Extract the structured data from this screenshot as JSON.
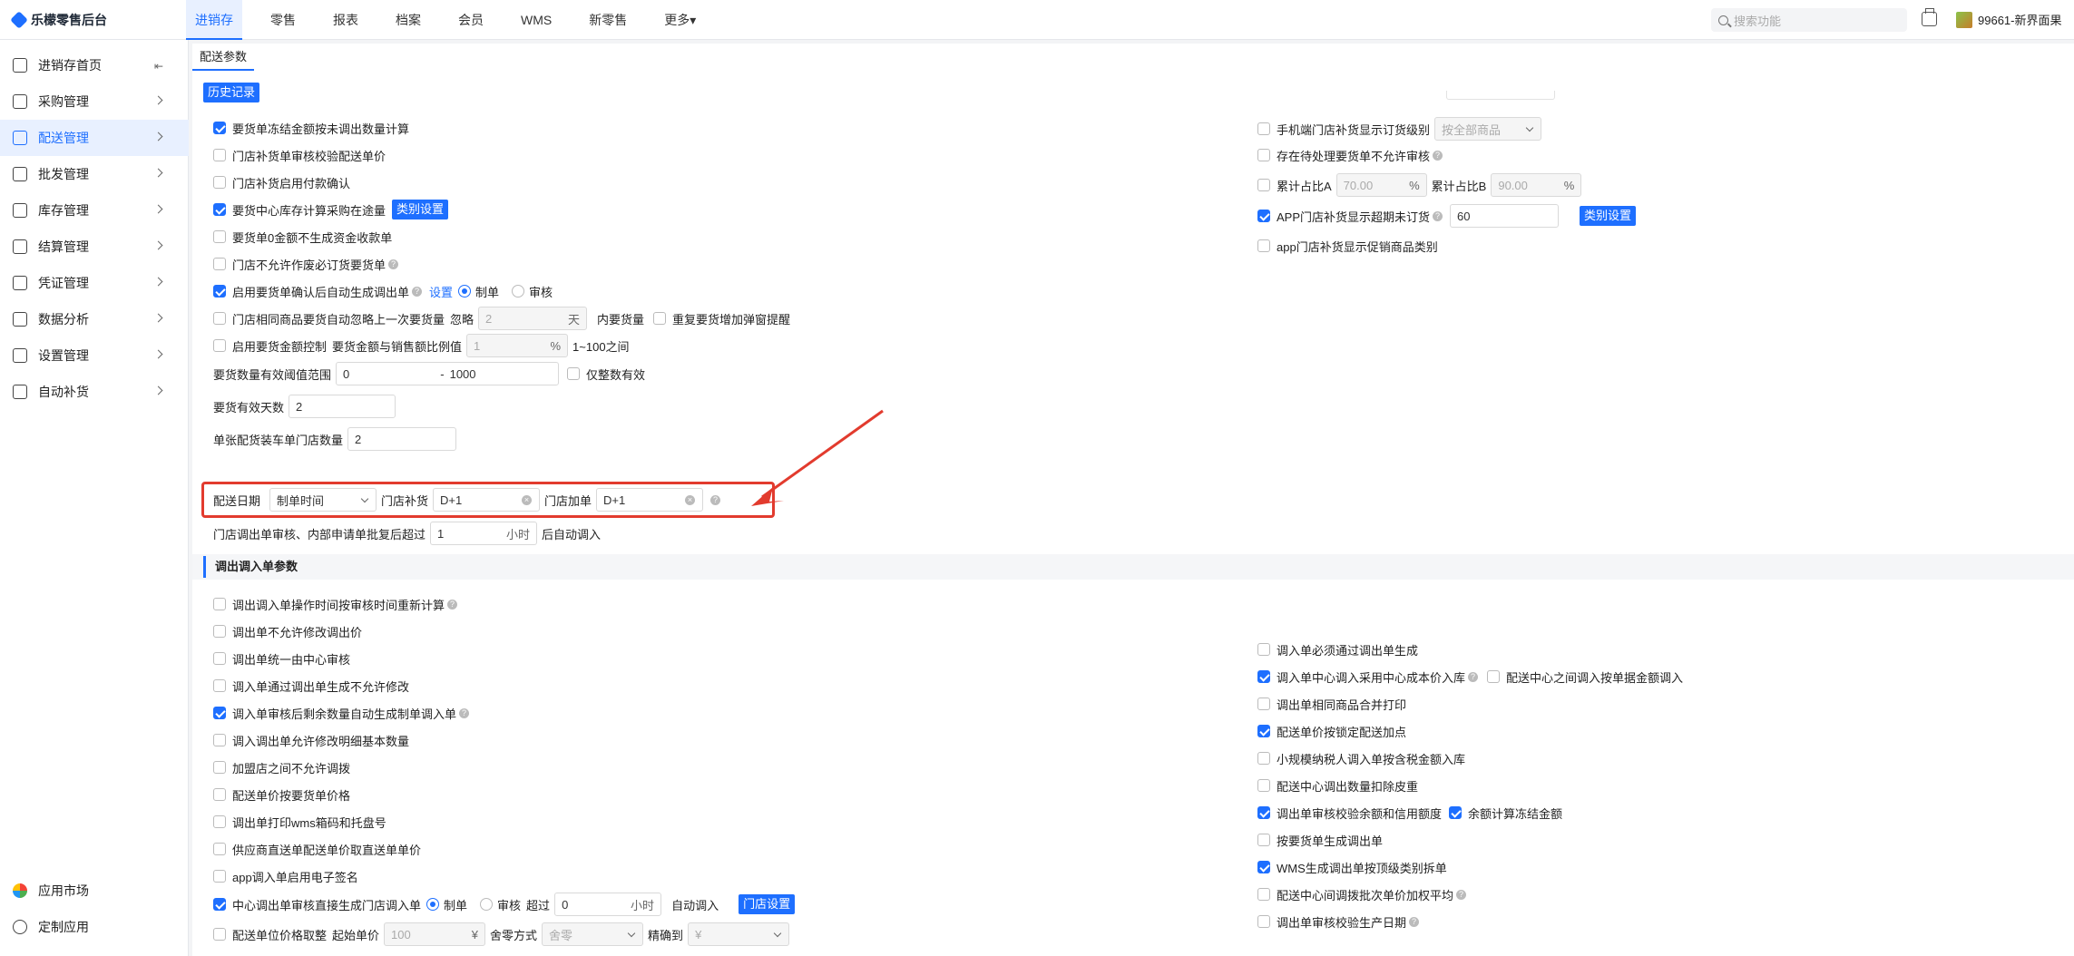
{
  "app": {
    "title": "乐檬零售后台"
  },
  "nav": [
    "进销存",
    "零售",
    "报表",
    "档案",
    "会员",
    "WMS",
    "新零售",
    "更多▾"
  ],
  "search": {
    "placeholder": "搜索功能"
  },
  "user": {
    "name": "99661-新界面果"
  },
  "sidebar": [
    "进销存首页",
    "采购管理",
    "配送管理",
    "批发管理",
    "库存管理",
    "结算管理",
    "凭证管理",
    "数据分析",
    "设置管理",
    "自动补货",
    "应用市场",
    "定制应用"
  ],
  "page": {
    "tab": "配送参数",
    "history_button": "历史记录"
  },
  "left": {
    "r1": "要货单冻结金额按未调出数量计算",
    "r2": "门店补货单审核校验配送单价",
    "r3": "门店补货启用付款确认",
    "r4": "要货中心库存计算采购在途量",
    "r4_btn": "类别设置",
    "r5": "要货单0金额不生成资金收款单",
    "r6": "门店不允许作废必订货要货单",
    "r7": "启用要货单确认后自动生成调出单",
    "r7_link": "设置",
    "r7_opt1": "制单",
    "r7_opt2": "审核",
    "r8": "门店相同商品要货自动忽略上一次要货量",
    "r8_ignore": "忽略",
    "r8_val": "2",
    "r8_unit": "天",
    "r8_within": "内要货量",
    "r8_popup": "重复要货增加弹窗提醒",
    "r9": "启用要货金额控制",
    "r9_ratio": "要货金额与销售额比例值",
    "r9_val": "1",
    "r9_unit": "%",
    "r9_range": "1~100之间",
    "r10": "要货数量有效阈值范围",
    "r10_from": "0",
    "r10_sep": "-",
    "r10_to": "1000",
    "r10_int": "仅整数有效",
    "r11": "要货有效天数",
    "r11_val": "2",
    "r12": "单张配货装车单门店数量",
    "r12_val": "2",
    "r13_label": "配送日期",
    "r13_sel": "制单时间",
    "r13_replenish": "门店补货",
    "r13_replenish_val": "D+1",
    "r13_add": "门店加单",
    "r13_add_val": "D+1",
    "r14": "门店调出单审核、内部申请单批复后超过",
    "r14_val": "1",
    "r14_unit": "小时",
    "r14_after": "后自动调入"
  },
  "right": {
    "r1": "手机端门店补货显示订货级别",
    "r1_sel": "按全部商品",
    "r2": "存在待处理要货单不允许审核",
    "r3a": "累计占比A",
    "r3a_val": "70.00",
    "r3a_unit": "%",
    "r3b": "累计占比B",
    "r3b_val": "90.00",
    "r3b_unit": "%",
    "r4": "APP门店补货显示超期未订货",
    "r4_val": "60",
    "r4_btn": "类别设置",
    "r5": "app门店补货显示促销商品类别"
  },
  "section2": {
    "title": "调出调入单参数",
    "left": [
      "调出调入单操作时间按审核时间重新计算",
      "调出单不允许修改调出价",
      "调出单统一由中心审核",
      "调入单通过调出单生成不允许修改",
      "调入单审核后剩余数量自动生成制单调入单",
      "调入调出单允许修改明细基本数量",
      "加盟店之间不允许调拨",
      "配送单价按要货单价格",
      "调出单打印wms箱码和托盘号",
      "供应商直送单配送单价取直送单单价",
      "app调入单启用电子签名"
    ],
    "right": [
      "调入单必须通过调出单生成",
      "调入单中心调入采用中心成本价入库",
      "调出单相同商品合并打印",
      "配送单价按锁定配送加点",
      "小规模纳税人调入单按含税金额入库",
      "配送中心调出数量扣除皮重",
      "调出单审核校验余额和信用额度",
      "按要货单生成调出单",
      "WMS生成调出单按顶级类别拆单",
      "配送中心间调拨批次单价加权平均",
      "调出单审核校验生产日期"
    ],
    "right_extra1": "配送中心之间调入按单据金额调入",
    "right_extra2": "余额计算冻结金额",
    "center": "中心调出单审核直接生成门店调入单",
    "center_opt1": "制单",
    "center_opt2": "审核",
    "center_over": "超过",
    "center_val": "0",
    "center_unit": "小时",
    "center_after": "自动调入",
    "center_btn": "门店设置",
    "round": "配送单位价格取整",
    "round_start": "起始单价",
    "round_start_val": "100",
    "round_start_unit": "¥",
    "round_mode": "舍零方式",
    "round_mode_val": "舍零",
    "round_precision": "精确到",
    "round_precision_val": "¥"
  }
}
